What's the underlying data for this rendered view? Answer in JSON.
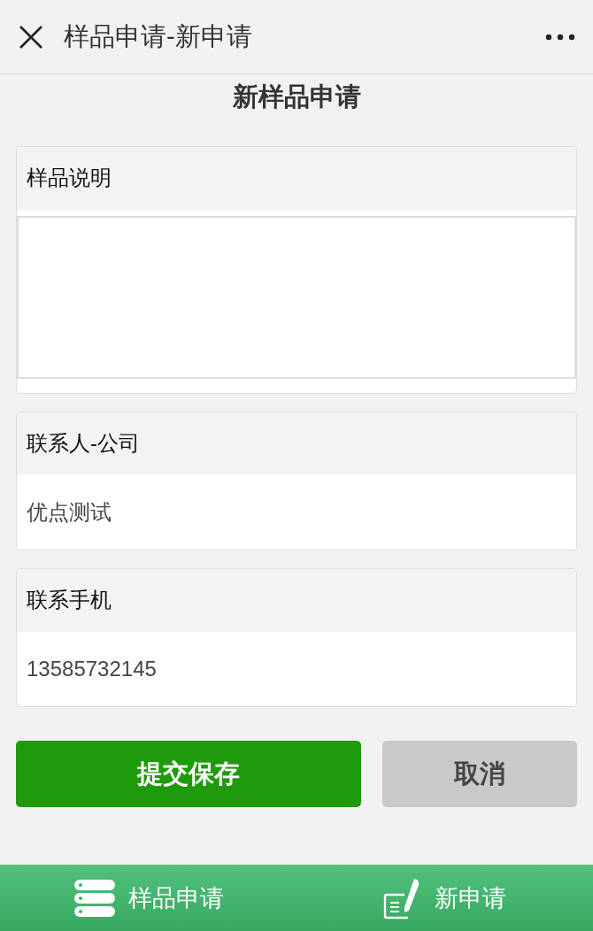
{
  "header": {
    "title": "样品申请-新申请"
  },
  "page_title": "新样品申请",
  "fields": [
    {
      "kind": "textarea",
      "label": "样品说明"
    },
    {
      "kind": "text",
      "label": "联系人-公司",
      "value": "优点测试"
    },
    {
      "kind": "text",
      "label": "联系手机",
      "value": "13585732145"
    }
  ],
  "buttons": [
    {
      "kind": "primary",
      "label": "提交保存"
    },
    {
      "kind": "secondary",
      "label": "取消"
    }
  ],
  "bottom_tabs": [
    {
      "kind": "list",
      "label": "样品申请"
    },
    {
      "kind": "write",
      "label": "新申请"
    }
  ]
}
